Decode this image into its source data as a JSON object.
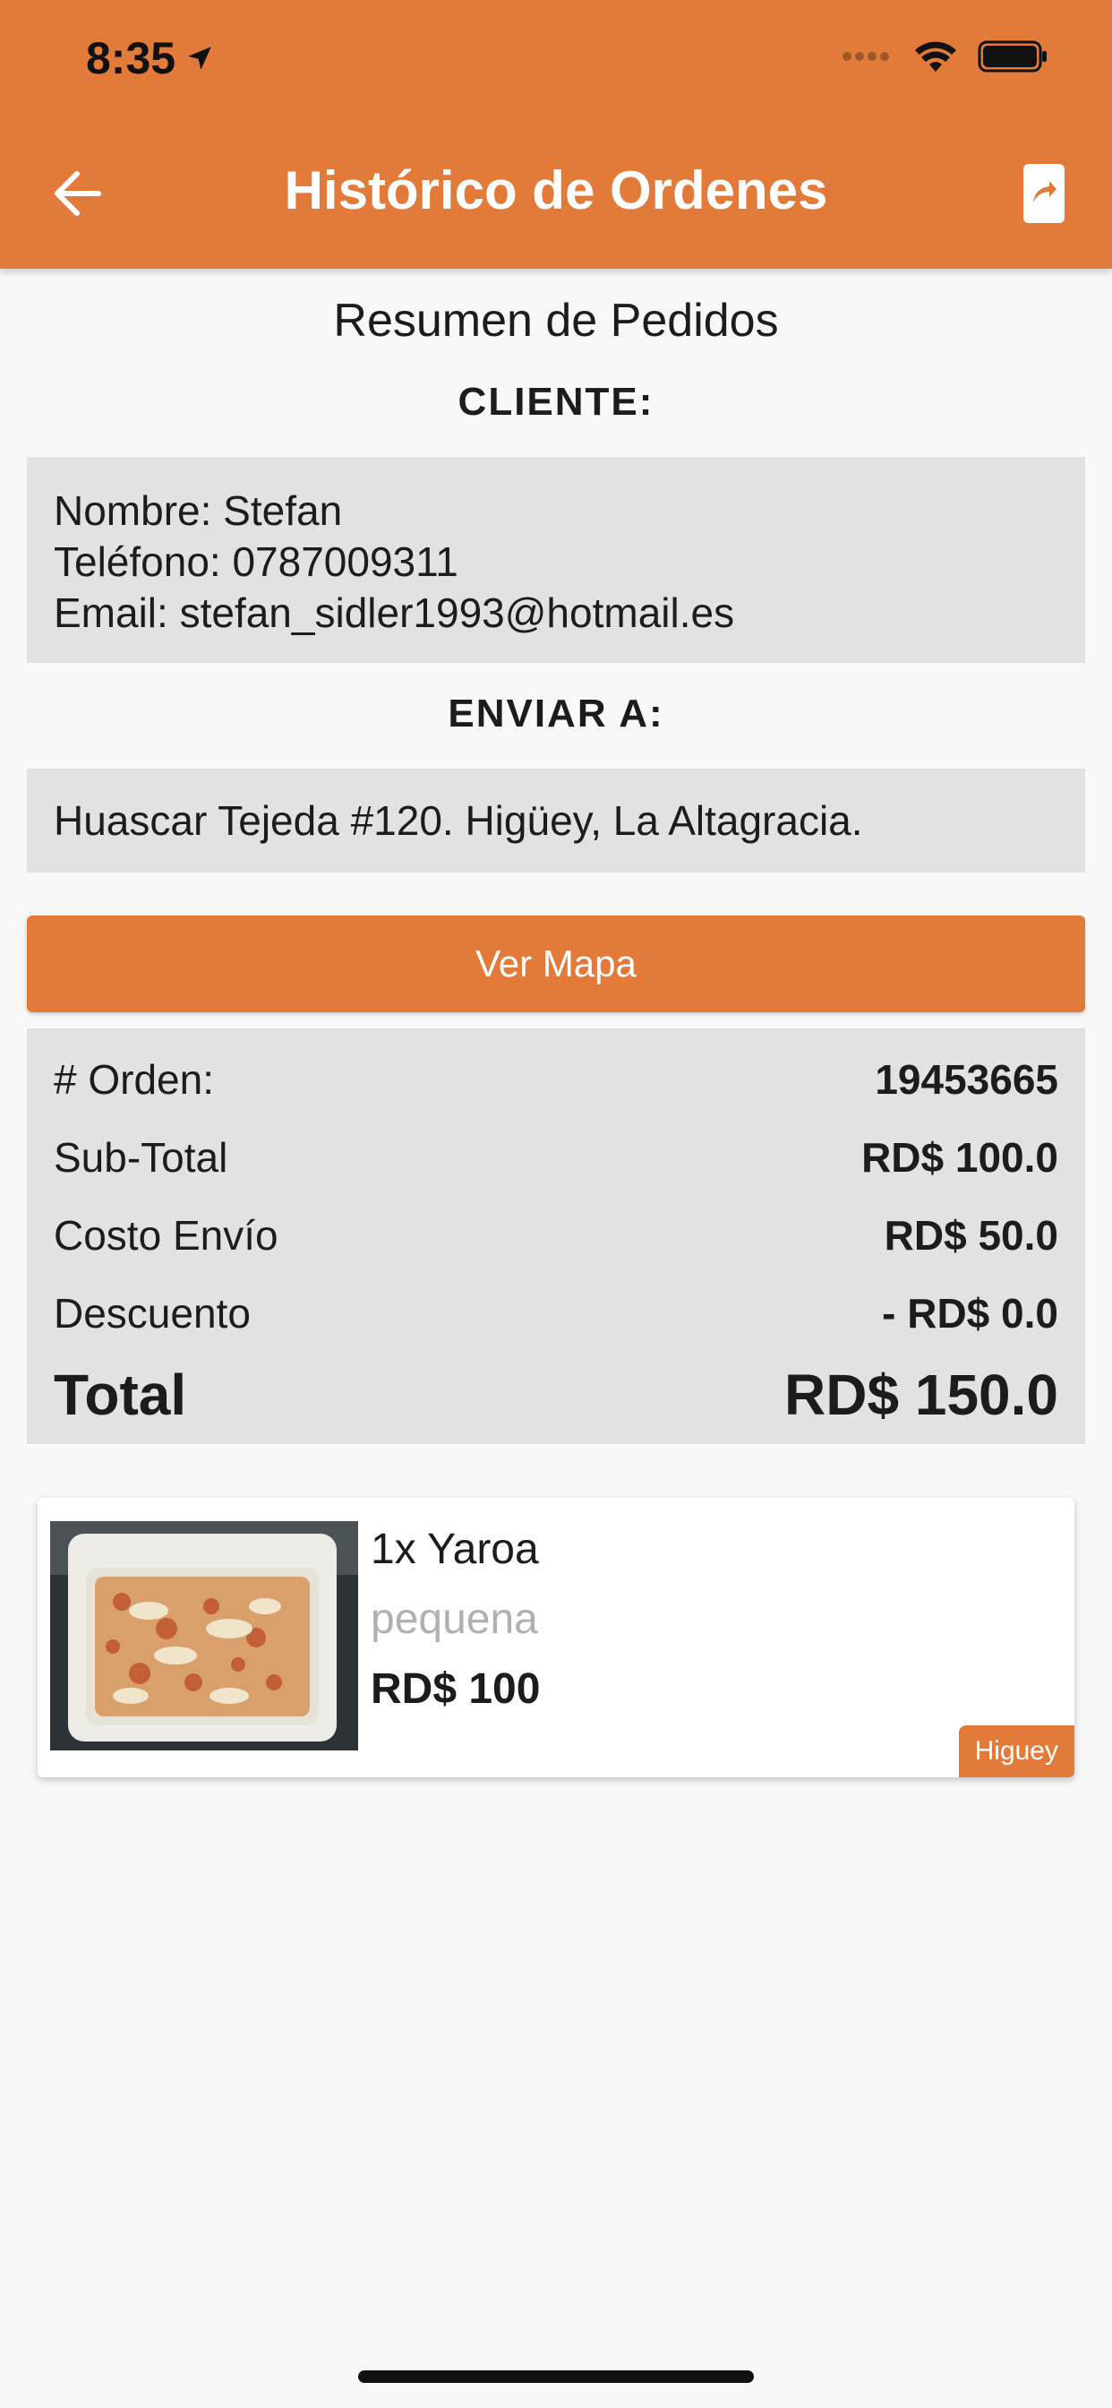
{
  "status_bar": {
    "time": "8:35"
  },
  "header": {
    "title": "Histórico de Ordenes"
  },
  "summary": {
    "title": "Resumen de Pedidos",
    "client_heading": "CLIENTE:",
    "client": {
      "name_line": "Nombre: Stefan",
      "phone_line": "Teléfono: 0787009311",
      "email_line": "Email: stefan_sidler1993@hotmail.es"
    },
    "ship_heading": "ENVIAR A:",
    "address": "Huascar Tejeda #120. Higüey, La Altagracia.",
    "map_button": "Ver Mapa"
  },
  "totals": {
    "order_label": "# Orden:",
    "order_value": "19453665",
    "subtotal_label": "Sub-Total",
    "subtotal_value": "RD$  100.0",
    "shipping_label": "Costo Envío",
    "shipping_value": "RD$  50.0",
    "discount_label": "Descuento",
    "discount_value": "- RD$  0.0",
    "total_label": "Total",
    "total_value": "RD$  150.0"
  },
  "items": [
    {
      "name": "1x Yaroa",
      "size": "pequena",
      "price": "RD$  100",
      "tag": "Higuey"
    }
  ],
  "colors": {
    "accent": "#e27b3a",
    "panel": "#e2e2e2",
    "background": "#f8f8f8"
  }
}
